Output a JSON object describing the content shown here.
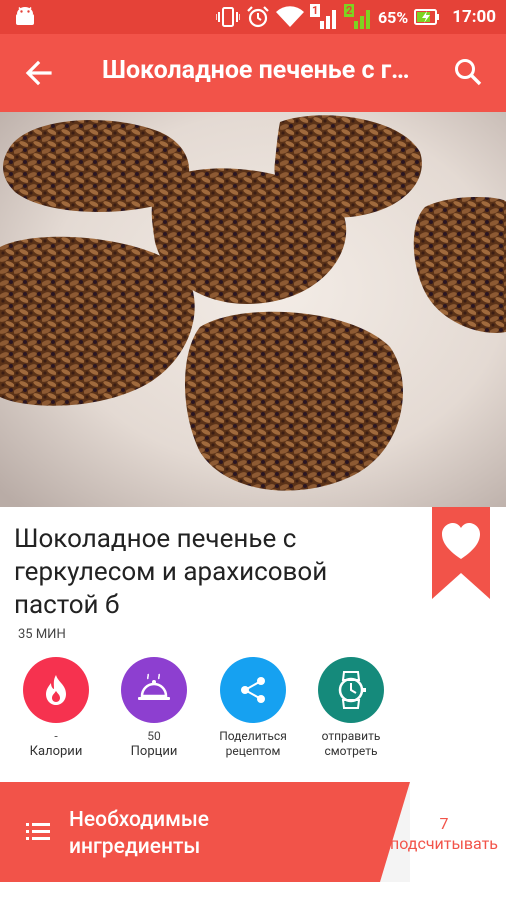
{
  "status_bar": {
    "battery": "65%",
    "time": "17:00",
    "sim1": "1",
    "sim2": "2",
    "icons": [
      "android-icon",
      "vibrate-icon",
      "alarm-icon",
      "wifi-icon",
      "signal-icon",
      "battery-charging-icon"
    ]
  },
  "app_bar": {
    "title": "Шоколадное печенье с геркулесом и арахисовой пастой б",
    "back_icon": "arrow-back-icon",
    "search_icon": "search-icon"
  },
  "recipe": {
    "title": "Шоколадное печенье с геркулесом и арахисовой пастой б",
    "time": "35 МИН",
    "favorite_icon": "heart-icon"
  },
  "actions": [
    {
      "value": "-",
      "label": "Калории",
      "icon": "flame-icon",
      "color": "#f6324f"
    },
    {
      "value": "50",
      "label": "Порции",
      "icon": "cloche-icon",
      "color": "#8d3fd0"
    },
    {
      "value": "",
      "label": "Поделиться рецептом",
      "icon": "share-icon",
      "color": "#16a1f1"
    },
    {
      "value": "",
      "label": "отправить смотреть",
      "icon": "watch-icon",
      "color": "#158a7b"
    }
  ],
  "ingredients": {
    "label": "Необходимые ингредиенты",
    "count": "7",
    "count_label": "подсчитывать"
  },
  "colors": {
    "primary": "#f25349",
    "status_bar": "#e54238"
  }
}
